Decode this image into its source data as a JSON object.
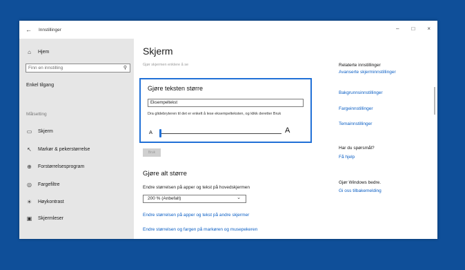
{
  "window": {
    "title": "Innstillinger",
    "minimize": "–",
    "maximize": "□",
    "close": "×"
  },
  "sidebar": {
    "home": "Hjem",
    "search_placeholder": "Finn en innstilling",
    "section_title": "Enkel tilgang",
    "group_label": "Målsetting",
    "items": [
      {
        "label": "Skjerm",
        "icon": "monitor-icon"
      },
      {
        "label": "Markør & pekerstørrelse",
        "icon": "pointer-icon"
      },
      {
        "label": "Forstørrelsesprogram",
        "icon": "magnifier-icon"
      },
      {
        "label": "Fargefiltre",
        "icon": "color-filter-icon"
      },
      {
        "label": "Høykontrast",
        "icon": "contrast-icon"
      },
      {
        "label": "Skjermleser",
        "icon": "narrator-icon"
      }
    ]
  },
  "main": {
    "title": "Skjerm",
    "subtitle": "Gjør skjermen enklere å se",
    "text_bigger": {
      "heading": "Gjøre teksten større",
      "sample": "Eksempeltekst",
      "hint": "Dra glidebryteren til det er enkelt å lese eksempelteksten, og klikk deretter Bruk",
      "slider_min_label": "A",
      "slider_max_label": "A",
      "slider_value": 0
    },
    "apply_label": "Bruk",
    "everything_bigger": {
      "heading": "Gjøre alt større",
      "label": "Endre størrelsen på apper og tekst på hovedskjermen",
      "dropdown_value": "200 % (Anbefalt)",
      "link1": "Endre størrelsen på apper og tekst på andre skjermer",
      "link2": "Endre størrelsen og fargen på markøren og musepekeren"
    }
  },
  "related": {
    "heading": "Relaterte innstillinger",
    "links": [
      "Avanserte skjerminnstillinger",
      "Bakgrunnsinnstillinger",
      "Fargeinnstillinger",
      "Temainnstillinger"
    ],
    "question_heading": "Har du spørsmål?",
    "help_link": "Få hjelp",
    "improve_heading": "Gjør Windows bedre.",
    "feedback_link": "Gi oss tilbakemelding"
  },
  "colors": {
    "accent": "#1f6fd6",
    "link": "#0a5ec4",
    "desktop": "#0f4f99",
    "sidebar": "#e6e6e6"
  }
}
